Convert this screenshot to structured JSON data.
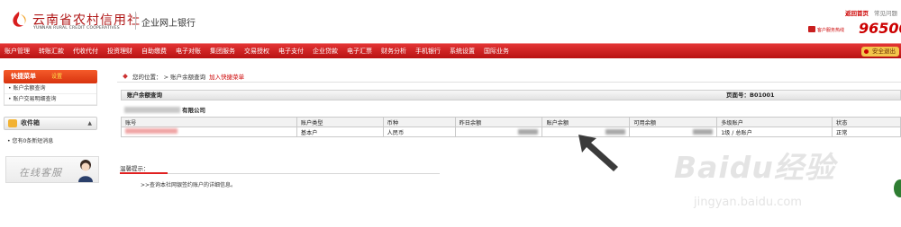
{
  "header": {
    "bank_name": "云南省农村信用社",
    "bank_name_en": "YUNNAN RURAL CREDIT COOPERATIVES",
    "sub_title": "企业网上银行",
    "links": {
      "home": "返回首页",
      "faq": "常见问题"
    },
    "hotline_label": "客户服务热线",
    "hotline_number": "96500",
    "brand_color": "#c01818"
  },
  "nav": {
    "items": [
      "账户管理",
      "转账汇款",
      "代收代付",
      "投资理财",
      "自助缴费",
      "电子对账",
      "集团服务",
      "交易授权",
      "电子支付",
      "企业贷款",
      "电子汇票",
      "财务分析",
      "手机银行",
      "系统设置",
      "国际业务"
    ],
    "exit_label": "安全退出"
  },
  "sidebar": {
    "quick_menu": "快捷菜单",
    "setting": "设置",
    "items": [
      "账户余额查询",
      "账户交易明细查询"
    ],
    "inbox_title": "收件箱",
    "inbox_message": "您有0条新短消息",
    "online_service": "在线客服"
  },
  "breadcrumb": {
    "prefix": "您的位置：",
    "current": "账户余额查询",
    "add_quick": "加入快捷菜单"
  },
  "main": {
    "title": "账户余额查询",
    "page_no": "页面号：B01001",
    "company_suffix": "有限公司",
    "columns": [
      "账号",
      "账户类型",
      "币种",
      "昨日余额",
      "账户余额",
      "可用余额",
      "多级账户",
      "状态"
    ],
    "rows": [
      {
        "account_type": "基本户",
        "currency": "人民币",
        "multi_level": "1级 / 总账户",
        "status": "正常"
      }
    ]
  },
  "tips": {
    "title": "温馨提示：",
    "text": ">>查询本社网银签约账户的详细信息。"
  },
  "watermark": {
    "logo": "Baidu经验",
    "url": "jingyan.baidu.com"
  }
}
